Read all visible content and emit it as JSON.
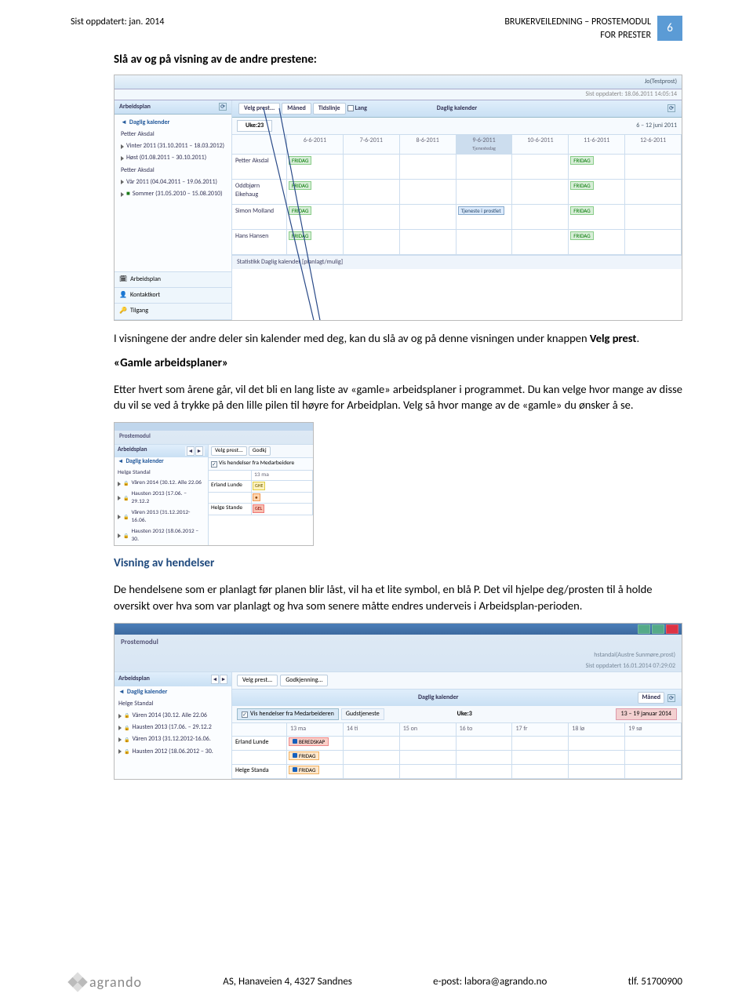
{
  "header": {
    "left": "Sist oppdatert: jan. 2014",
    "right_line1": "BRUKERVEILEDNING – PROSTEMODUL",
    "right_line2": "FOR PRESTER",
    "page_num": "6"
  },
  "sections": {
    "title1": "Slå av og på visning av de andre prestene:",
    "para1_a": "I visningene der andre deler sin kalender med deg, kan du slå av og på denne visningen under knappen ",
    "para1_b": "Velg prest",
    "para1_c": ".",
    "title2": "«Gamle arbeidsplaner»",
    "para2": "Etter hvert som årene går, vil det bli en lang liste av «gamle» arbeidsplaner i programmet. Du kan velge hvor mange av disse du vil se ved å trykke på den lille pilen til høyre for Arbeidplan. Velg så hvor mange av de «gamle» du ønsker å se.",
    "title3": "Visning av hendelser",
    "para3": "De hendelsene som er planlagt før planen blir låst, vil ha et lite symbol, en blå P. Det vil hjelpe deg/prosten til å holde oversikt over hva som var planlagt og hva som senere måtte endres underveis i Arbeidsplan-perioden."
  },
  "ss1": {
    "user_role": "Jo(Testprost)",
    "updated": "Sist oppdatert: 18.06.2011 14:05:14",
    "sidebar_title": "Arbeidsplan",
    "sidebar_items": [
      "Daglig kalender",
      "Petter Aksdal",
      "Vinter 2011 (31.10.2011 – 18.03.2012)",
      "Høst (01.08.2011 – 30.10.2011)",
      "Petter Aksdal",
      "Vår 2011 (04.04.2011 – 19.06.2011)",
      "Sommer (31.05.2010 – 15.08.2010)"
    ],
    "sidebar_bottom": [
      "Arbeidsplan",
      "Kontaktkort",
      "Tilgang"
    ],
    "calendar_title": "Daglig kalender",
    "toolbar": {
      "velg_prest": "Velg prest...",
      "maned": "Måned",
      "tidslinje": "Tidslinje",
      "lang": "Lang"
    },
    "week_label": "Uke:23",
    "range": "6 – 12 juni 2011",
    "dates": [
      "6-6-2011",
      "7-6-2011",
      "8-6-2011",
      "9-6-2011",
      "10-6-2011",
      "11-6-2011",
      "12-6-2011"
    ],
    "special_days": {
      "9": "Tjenestedag"
    },
    "rows": [
      {
        "name": "Petter Aksdal",
        "fri": [
          0,
          5
        ],
        "tjen": []
      },
      {
        "name": "Oddbjørn Eikehaug",
        "fri": [
          0,
          5
        ],
        "tjen": []
      },
      {
        "name": "Simon Molland",
        "fri": [
          0,
          5
        ],
        "tjen": [
          3
        ]
      },
      {
        "name": "Hans Hansen",
        "fri": [
          0,
          5
        ],
        "tjen": []
      }
    ],
    "fridag_label": "FRIDAG",
    "tjen_label": "Tjeneste i prostiet",
    "stat_label": "Statistikk Daglig kalender  [planlagt/mulig]"
  },
  "ss2": {
    "pm_title": "Prostemodul",
    "sidebar_title": "Arbeidsplan",
    "sidebar_items": [
      "Daglig kalender",
      "Helge Standal",
      "Våren 2014 (30.12. Alle 22.06",
      "Hausten 2013 (17.06. – 29.12.2",
      "Våren 2013 (31.12.2012-16.06.",
      "Hausten 2012 (18.06.2012 – 30."
    ],
    "toolbar": {
      "velg_prest": "Velg prest...",
      "godkj": "Godkj"
    },
    "checkbox_label": "Vis hendelser fra Medarbeidere",
    "day_head": "13 ma",
    "rows": [
      {
        "name": "Erland Lunde",
        "chips": [
          "GHE"
        ]
      },
      {
        "name": "Helge Stande",
        "chips": [
          "GEL"
        ]
      }
    ]
  },
  "ss3": {
    "pm_title": "Prostemodul",
    "user_role": "hstandal(Austre Sunmøre,prost)",
    "updated": "Sist oppdatert 16.01.2014 07:29:02",
    "sidebar_title": "Arbeidsplan",
    "sidebar_items": [
      "Daglig kalender",
      "Helge Standal",
      "Våren 2014 (30.12. Alle 22.06",
      "Hausten 2013 (17.06. – 29.12.2",
      "Våren 2013 (31.12.2012-16.06.",
      "Hausten 2012 (18.06.2012 – 30."
    ],
    "calendar_title": "Daglig kalender",
    "toolbar": {
      "velg_prest": "Velg prest...",
      "godkj": "Godkjenning...",
      "cbx": "Vis hendelser fra Medarbeideren",
      "cbx2": "Gudstjeneste"
    },
    "maned_btn": "Måned",
    "week_label": "Uke:3",
    "range": "13 – 19 januar 2014",
    "dates": [
      "13 ma",
      "14 ti",
      "15 on",
      "16 to",
      "17 fr",
      "18 lø",
      "19 sø"
    ],
    "rows": [
      {
        "name": "Erland Lunde",
        "chips": [
          {
            "col": 0,
            "type": "red",
            "label": "BEREDSKAP"
          },
          {
            "col": 0,
            "type": "or",
            "label": "FRIDAG"
          }
        ]
      },
      {
        "name": "Helge Standa",
        "chips": [
          {
            "col": 0,
            "type": "or",
            "label": "FRIDAG"
          }
        ]
      }
    ]
  },
  "footer": {
    "brand": "agrando",
    "address": "AS, Hanaveien 4, 4327 Sandnes",
    "email": "e-post: labora@agrando.no",
    "phone": "tlf. 51700900"
  }
}
